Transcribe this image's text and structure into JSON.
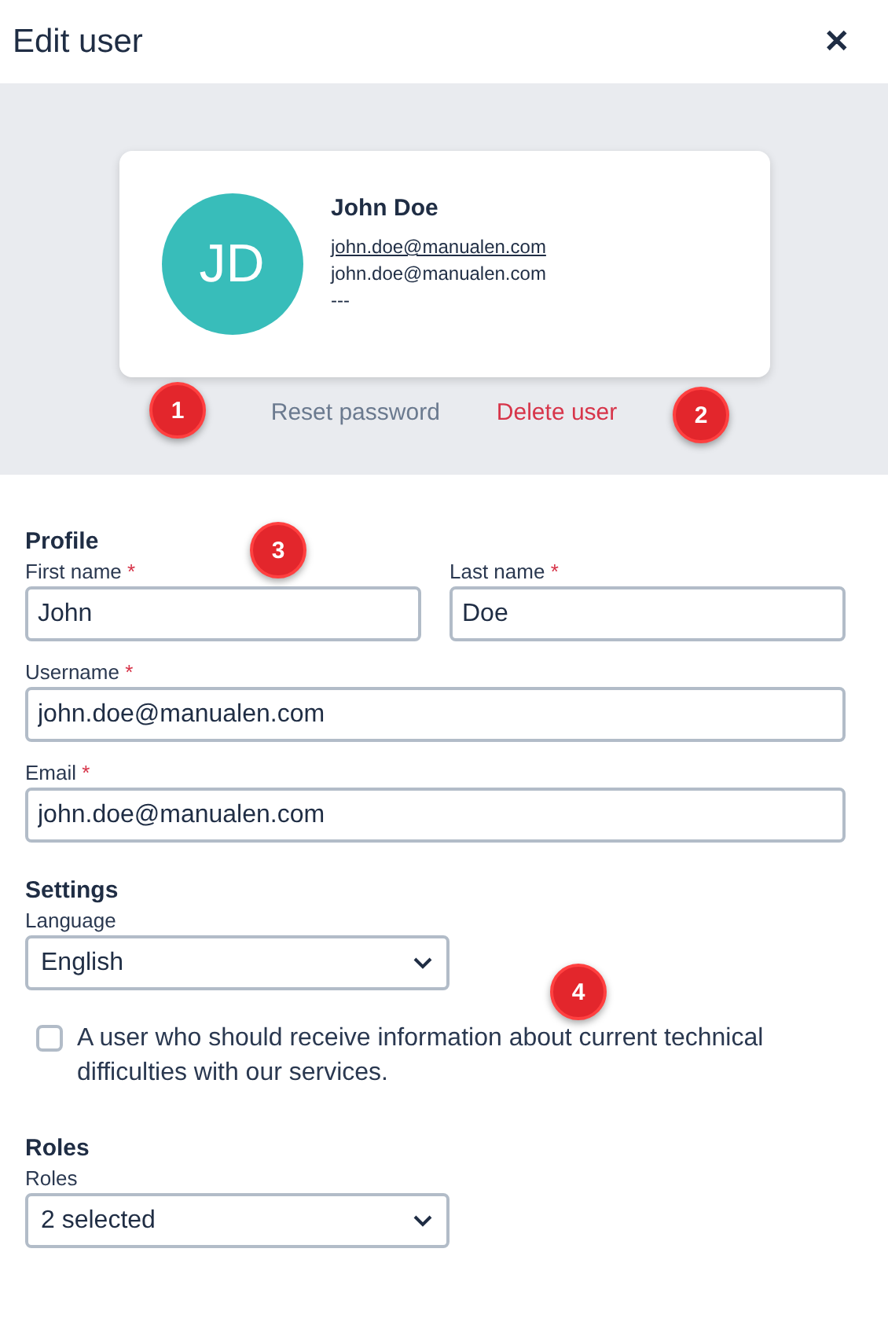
{
  "window": {
    "title": "Edit user",
    "close": "✕"
  },
  "user_card": {
    "initials": "JD",
    "name": "John Doe",
    "email_link": "john.doe@manualen.com",
    "email": "john.doe@manualen.com",
    "extra": "---"
  },
  "actions": [
    {
      "label": "Reset password",
      "kind": "neutral"
    },
    {
      "label": "Delete user",
      "kind": "danger"
    }
  ],
  "profile": {
    "heading": "Profile",
    "fields": [
      {
        "label": "First name",
        "required": "*",
        "value": "John",
        "kind": "half"
      },
      {
        "label": "Last name",
        "required": "*",
        "value": "Doe",
        "kind": "half"
      },
      {
        "label": "Username",
        "required": "*",
        "value": "john.doe@manualen.com",
        "kind": "full"
      },
      {
        "label": "Email",
        "required": "*",
        "value": "john.doe@manualen.com",
        "kind": "full"
      }
    ]
  },
  "settings": {
    "heading": "Settings",
    "language": {
      "label": "Language",
      "value": "English"
    },
    "checkbox": {
      "label": "A user who should receive information about current technical difficulties with our services.",
      "checked": false
    }
  },
  "roles": {
    "heading": "Roles",
    "select": {
      "label": "Roles",
      "value": "2 selected"
    }
  },
  "callouts": [
    "1",
    "2",
    "3",
    "4"
  ]
}
